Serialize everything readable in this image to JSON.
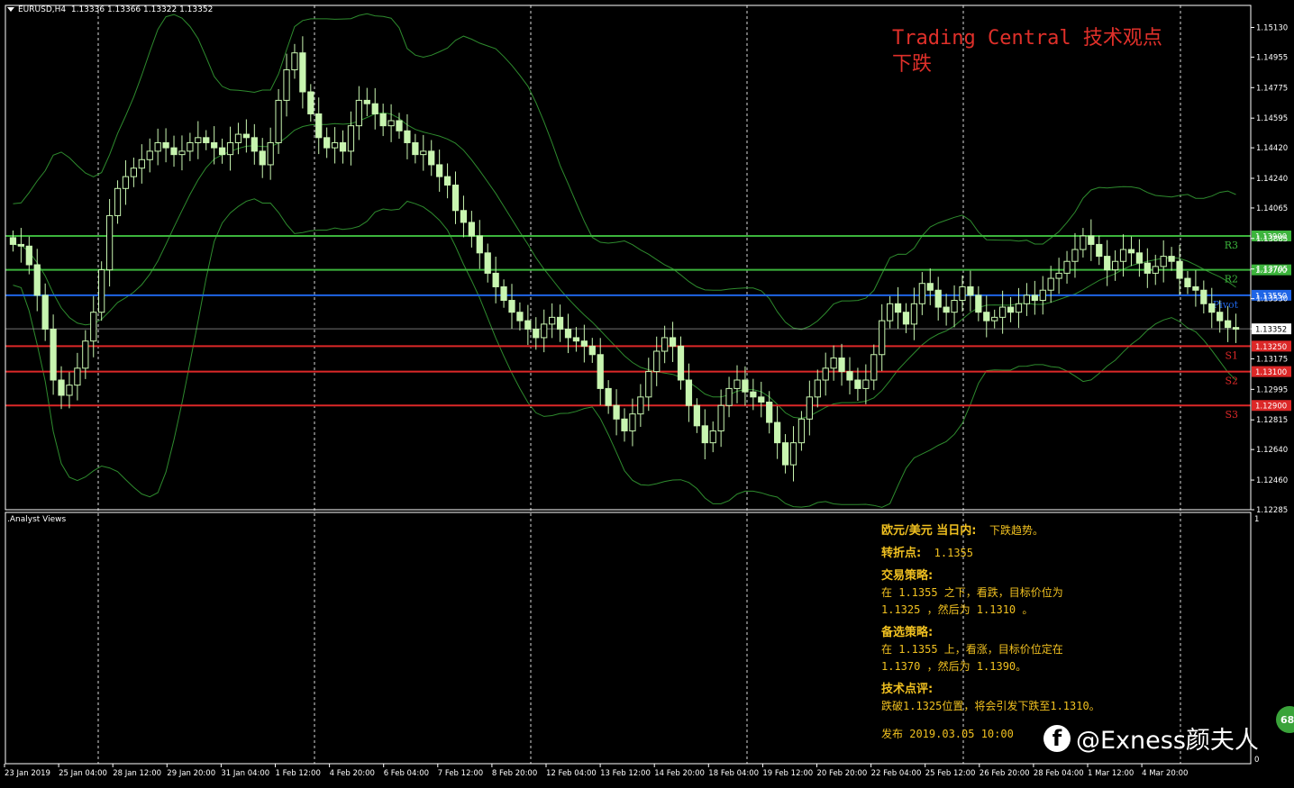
{
  "header": {
    "symbol": "EURUSD,H4",
    "ohlc": "1.13336 1.13366 1.13322 1.13352"
  },
  "overlay": {
    "title": "Trading Central 技术观点",
    "direction": "下跌"
  },
  "sub_header": ".Analyst Views",
  "sub_axis_top": "1",
  "sub_axis_bottom": "0",
  "panel": {
    "line1_label": "欧元/美元 当日内:",
    "line1_value": "下跌趋势。",
    "pivot_label": "转折点:",
    "pivot_value": "1.1355",
    "strategy_title": "交易策略:",
    "strategy_line1": "在 1.1355 之下，看跌，目标价位为",
    "strategy_line2": "1.1325 ，然后为 1.1310 。",
    "alt_title": "备选策略:",
    "alt_line1": "在 1.1355  上，看涨，目标价位定在",
    "alt_line2": "1.1370 ，然后为 1.1390。",
    "comment_title": "技术点评:",
    "comment_text": "跌破1.1325位置，将会引发下跌至1.1310。",
    "published": "发布 2019.03.05 10:00"
  },
  "watermark": {
    "handle": "@Exness颜夫人",
    "fb_letter": "f"
  },
  "badge": "68",
  "colors": {
    "background": "#000000",
    "grid": "#ffffff",
    "candle": "#c8f5b0",
    "band": "#2e8b2e",
    "resistance": "#3cb43c",
    "pivot": "#1e64e6",
    "support": "#dc2828",
    "current": "#c0c0c0",
    "title": "#e0302a",
    "panel_text": "#f0c020"
  },
  "chart_data": {
    "type": "candlestick",
    "symbol": "EURUSD",
    "timeframe": "H4",
    "y_ticks": [
      1.1513,
      1.14955,
      1.14775,
      1.14595,
      1.1442,
      1.1424,
      1.14065,
      1.13885,
      1.13705,
      1.1353,
      1.13352,
      1.13175,
      1.12995,
      1.12815,
      1.1264,
      1.1246,
      1.12285
    ],
    "ylim": [
      1.12285,
      1.1526
    ],
    "x_labels": [
      "23 Jan 2019",
      "25 Jan 04:00",
      "28 Jan 12:00",
      "29 Jan 20:00",
      "31 Jan 04:00",
      "1 Feb 12:00",
      "4 Feb 20:00",
      "6 Feb 04:00",
      "7 Feb 12:00",
      "8 Feb 20:00",
      "12 Feb 04:00",
      "13 Feb 12:00",
      "14 Feb 20:00",
      "18 Feb 04:00",
      "19 Feb 12:00",
      "20 Feb 20:00",
      "22 Feb 04:00",
      "25 Feb 12:00",
      "26 Feb 20:00",
      "28 Feb 04:00",
      "1 Mar 12:00",
      "4 Mar 20:00"
    ],
    "levels": [
      {
        "label": "R3",
        "value": 1.139,
        "tag": "1.13900",
        "kind": "resistance"
      },
      {
        "label": "R2",
        "value": 1.137,
        "tag": "1.13700",
        "kind": "resistance"
      },
      {
        "label": "Pivot",
        "value": 1.1355,
        "tag": "1.13550",
        "kind": "pivot"
      },
      {
        "label": "S1",
        "value": 1.1325,
        "tag": "1.13250",
        "kind": "support"
      },
      {
        "label": "S2",
        "value": 1.131,
        "tag": "1.13100",
        "kind": "support"
      },
      {
        "label": "S3",
        "value": 1.129,
        "tag": "1.12900",
        "kind": "support"
      }
    ],
    "current_price": 1.13352,
    "current_tag": "1.13352",
    "close_path": [
      1.1385,
      1.1384,
      1.1373,
      1.1355,
      1.1335,
      1.1305,
      1.1296,
      1.1302,
      1.1312,
      1.1328,
      1.1345,
      1.137,
      1.1402,
      1.1418,
      1.1425,
      1.143,
      1.1435,
      1.144,
      1.1445,
      1.1442,
      1.1438,
      1.144,
      1.1445,
      1.1448,
      1.1445,
      1.1442,
      1.1438,
      1.1445,
      1.145,
      1.1448,
      1.144,
      1.1432,
      1.1445,
      1.147,
      1.1488,
      1.1498,
      1.1475,
      1.1462,
      1.1448,
      1.1442,
      1.1445,
      1.144,
      1.1455,
      1.147,
      1.1468,
      1.1462,
      1.1455,
      1.1458,
      1.1452,
      1.1445,
      1.1438,
      1.144,
      1.1432,
      1.1425,
      1.142,
      1.1405,
      1.1398,
      1.139,
      1.138,
      1.1368,
      1.136,
      1.1352,
      1.1345,
      1.134,
      1.1335,
      1.133,
      1.1338,
      1.1342,
      1.1335,
      1.133,
      1.1328,
      1.1325,
      1.132,
      1.13,
      1.129,
      1.1282,
      1.1275,
      1.1285,
      1.1295,
      1.131,
      1.1322,
      1.133,
      1.1325,
      1.1305,
      1.129,
      1.1278,
      1.1268,
      1.1275,
      1.129,
      1.13,
      1.1305,
      1.1298,
      1.1295,
      1.1292,
      1.128,
      1.1268,
      1.1255,
      1.1268,
      1.1282,
      1.1295,
      1.1305,
      1.1312,
      1.1318,
      1.131,
      1.1305,
      1.13,
      1.1305,
      1.132,
      1.134,
      1.135,
      1.1345,
      1.1338,
      1.135,
      1.1362,
      1.1358,
      1.1348,
      1.1345,
      1.1352,
      1.136,
      1.1355,
      1.1345,
      1.134,
      1.1342,
      1.1348,
      1.1345,
      1.135,
      1.1355,
      1.1352,
      1.1358,
      1.1365,
      1.1368,
      1.1375,
      1.1382,
      1.139,
      1.1385,
      1.1378,
      1.137,
      1.1375,
      1.1382,
      1.138,
      1.1374,
      1.1368,
      1.1372,
      1.1378,
      1.1375,
      1.1365,
      1.136,
      1.1358,
      1.135,
      1.1345,
      1.134,
      1.1336,
      1.1335
    ]
  }
}
